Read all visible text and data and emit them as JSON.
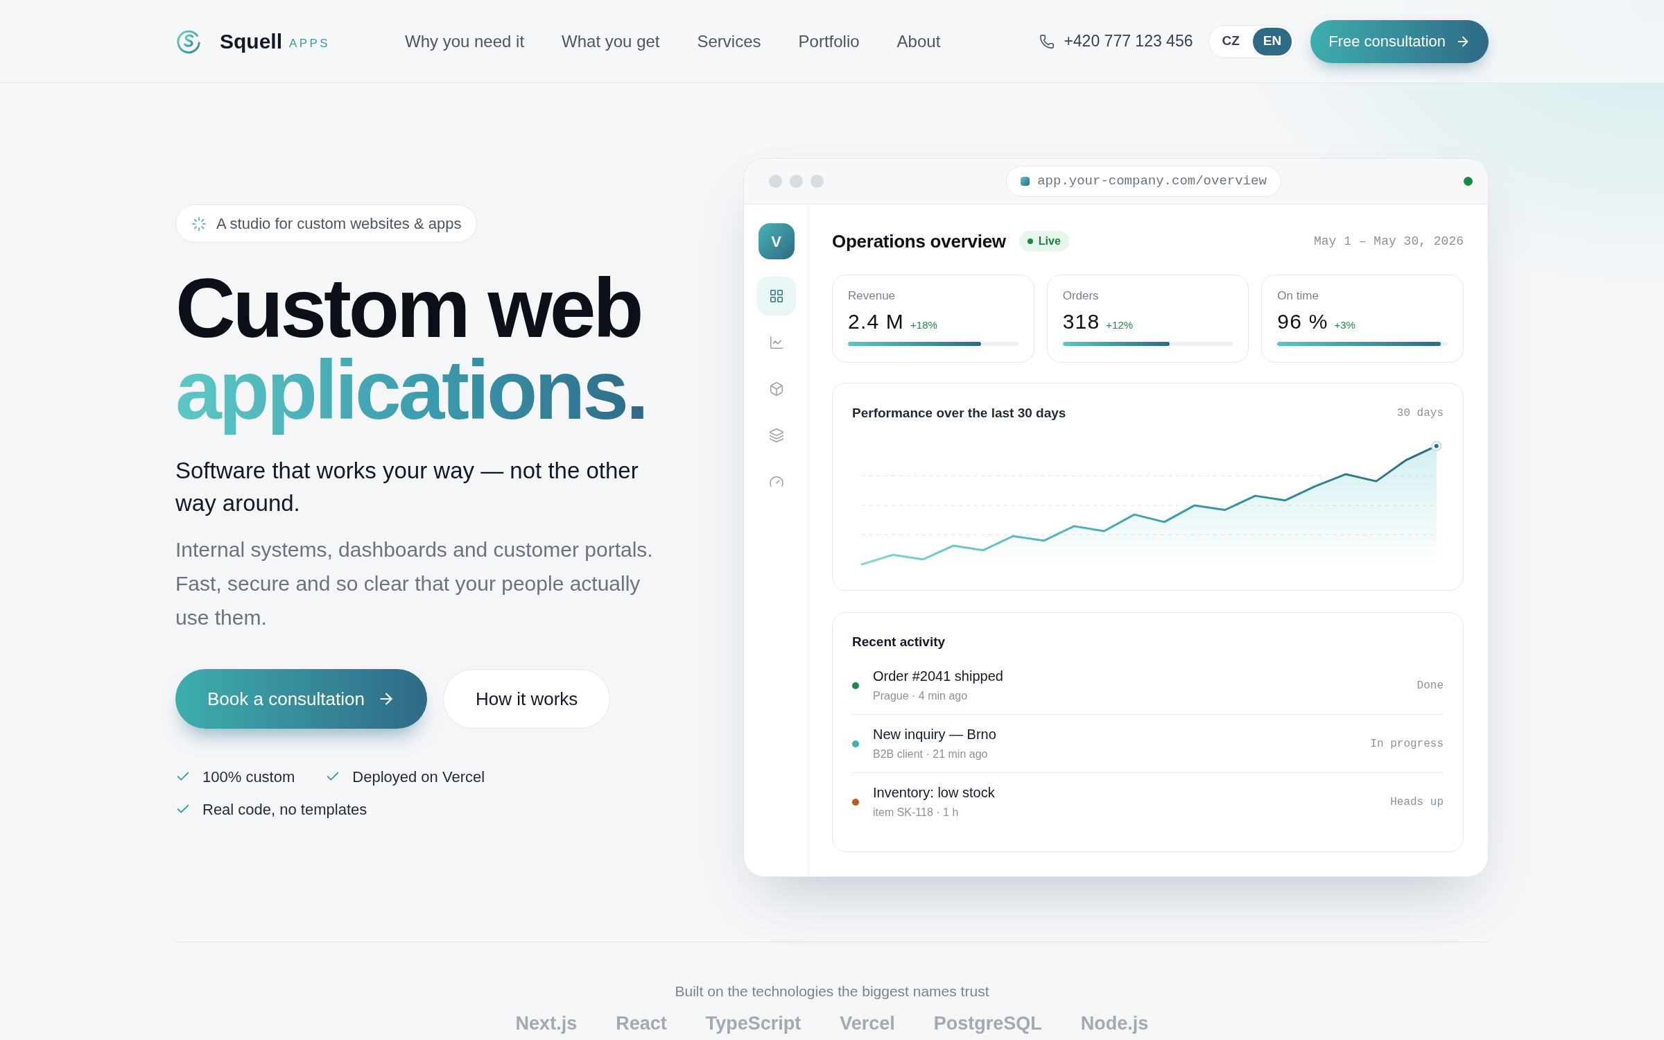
{
  "header": {
    "logo": {
      "name": "Squell",
      "suffix": "APPS"
    },
    "nav": [
      "Why you need it",
      "What you get",
      "Services",
      "Portfolio",
      "About"
    ],
    "phone": "+420 777 123 456",
    "languages": [
      {
        "label": "CZ",
        "selected": false
      },
      {
        "label": "EN",
        "selected": true
      }
    ],
    "cta": "Free consultation"
  },
  "hero": {
    "badge": "A studio for custom websites & apps",
    "title": "Custom web",
    "title_highlight": "applications.",
    "subtitle": "Software that works your way — not the other way around.",
    "description": "Internal systems, dashboards and customer portals. Fast, secure and so clear that your people actually use them.",
    "buttons": [
      {
        "label": "Book a consultation",
        "kind": "primary"
      },
      {
        "label": "How it works",
        "kind": "secondary"
      }
    ],
    "features": [
      "100% custom",
      "Deployed on Vercel",
      "Real code, no templates"
    ]
  },
  "dashboard": {
    "url": "app.your-company.com/overview",
    "avatar": "V",
    "sidebar": [
      {
        "selected": true
      },
      {
        "selected": false
      },
      {
        "selected": false
      },
      {
        "selected": false
      },
      {
        "selected": false
      }
    ],
    "title": "Operations overview",
    "status": "Live",
    "date_range": "May 1 – May 30, 2026",
    "stats": [
      {
        "label": "Revenue",
        "value": "2.4 M",
        "change": "+18%",
        "level": 0.78
      },
      {
        "label": "Orders",
        "value": "318",
        "change": "+12%",
        "level": 0.63
      },
      {
        "label": "On time",
        "value": "96 %",
        "change": "+3%",
        "level": 0.96
      }
    ],
    "chart": {
      "title": "Performance over the last 30 days",
      "period": "30 days"
    },
    "activity": {
      "title": "Recent activity",
      "items": [
        {
          "title": "Order #2041 shipped",
          "detail": "Prague · 4 min ago",
          "status": "Done",
          "color": "#1a8a45"
        },
        {
          "title": "New inquiry — Brno",
          "detail": "B2B client · 21 min ago",
          "status": "In progress",
          "color": "#3fb0b8"
        },
        {
          "title": "Inventory: low stock",
          "detail": "item SK-118 · 1 h",
          "status": "Heads up",
          "color": "#c2581a"
        }
      ]
    }
  },
  "tech": {
    "caption": "Built on the technologies the biggest names trust",
    "items": [
      "Next.js",
      "React",
      "TypeScript",
      "Vercel",
      "PostgreSQL",
      "Node.js"
    ]
  }
}
